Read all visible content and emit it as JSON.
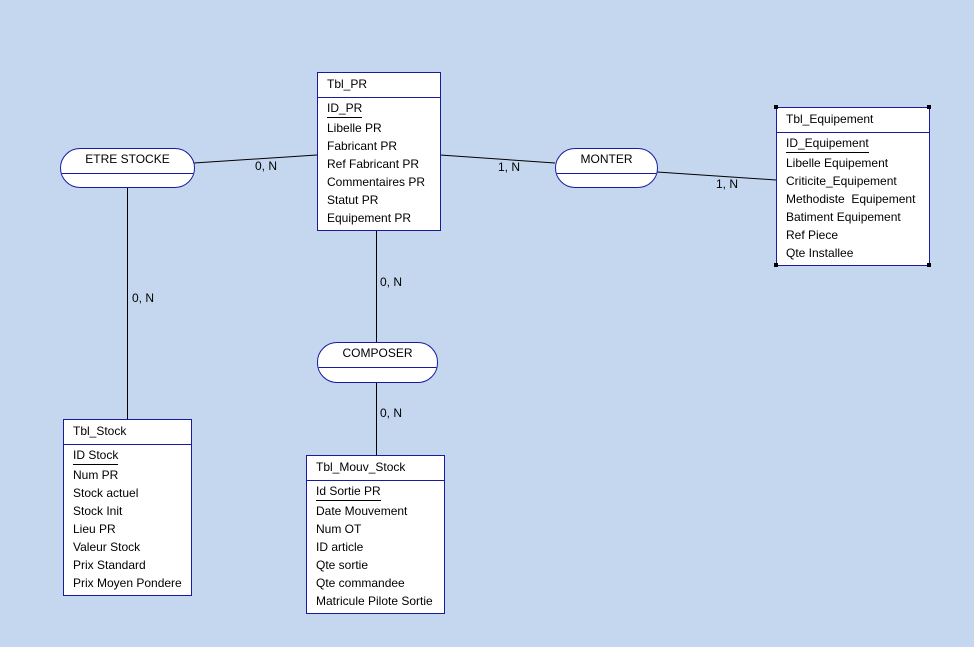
{
  "entities": {
    "tbl_pr": {
      "title": "Tbl_PR",
      "attributes": [
        "ID_PR",
        "Libelle PR",
        "Fabricant PR",
        "Ref Fabricant PR",
        "Commentaires PR",
        "Statut PR",
        "Equipement PR"
      ]
    },
    "tbl_equipement": {
      "title": "Tbl_Equipement",
      "attributes": [
        "ID_Equipement",
        "Libelle Equipement",
        "Criticite_Equipement",
        "Methodiste  Equipement",
        "Batiment Equipement",
        "Ref Piece",
        "Qte Installee"
      ]
    },
    "tbl_stock": {
      "title": "Tbl_Stock",
      "attributes": [
        "ID Stock",
        "Num PR",
        "Stock actuel",
        "Stock Init",
        "Lieu PR",
        "Valeur Stock",
        "Prix Standard",
        "Prix Moyen Pondere"
      ]
    },
    "tbl_mouv_stock": {
      "title": "Tbl_Mouv_Stock",
      "attributes": [
        "Id Sortie PR",
        "Date Mouvement",
        "Num OT",
        "ID article",
        "Qte sortie",
        "Qte commandee",
        "Matricule Pilote Sortie"
      ]
    }
  },
  "relationships": {
    "etre_stocke": "ETRE STOCKE",
    "monter": "MONTER",
    "composer": "COMPOSER"
  },
  "cardinalities": {
    "etre_stocke_pr": "0, N",
    "etre_stocke_stock": "0, N",
    "monter_pr": "1, N",
    "monter_equipement": "1, N",
    "composer_pr": "0, N",
    "composer_mouv": "0, N"
  },
  "colors": {
    "background": "#c4d7ee",
    "border": "#1a1aa0"
  }
}
